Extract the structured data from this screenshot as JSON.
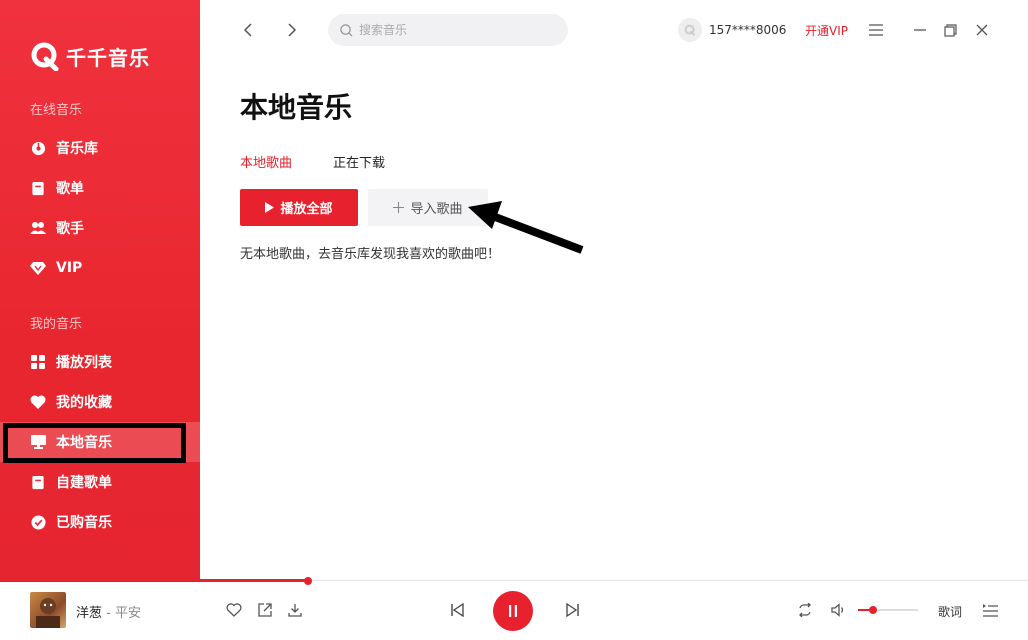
{
  "app": {
    "name": "千千音乐"
  },
  "sidebar": {
    "section_online": "在线音乐",
    "section_mine": "我的音乐",
    "online_items": [
      {
        "label": "音乐库",
        "icon": "disc-icon"
      },
      {
        "label": "歌单",
        "icon": "playlist-icon"
      },
      {
        "label": "歌手",
        "icon": "singer-icon"
      },
      {
        "label": "VIP",
        "icon": "diamond-icon"
      }
    ],
    "mine_items": [
      {
        "label": "播放列表",
        "icon": "grid-icon"
      },
      {
        "label": "我的收藏",
        "icon": "heart-icon"
      },
      {
        "label": "本地音乐",
        "icon": "monitor-icon",
        "active": true
      },
      {
        "label": "自建歌单",
        "icon": "document-icon"
      },
      {
        "label": "已购音乐",
        "icon": "check-circle-icon"
      }
    ]
  },
  "topbar": {
    "search_placeholder": "搜索音乐",
    "user_name": "157****8006",
    "vip_label": "开通VIP"
  },
  "main": {
    "title": "本地音乐",
    "tabs": [
      {
        "label": "本地歌曲",
        "active": true
      },
      {
        "label": "正在下载",
        "active": false
      }
    ],
    "play_all_label": "播放全部",
    "import_label": "导入歌曲",
    "empty_message": "无本地歌曲，去音乐库发现我喜欢的歌曲吧！"
  },
  "player": {
    "track_title": "洋葱",
    "separator": " - ",
    "artist": "平安",
    "lyrics_label": "歌词",
    "progress": 0.3,
    "volume": 0.25,
    "state": "playing"
  },
  "colors": {
    "accent": "#e8212e",
    "sidebar": "#ec2c37"
  }
}
